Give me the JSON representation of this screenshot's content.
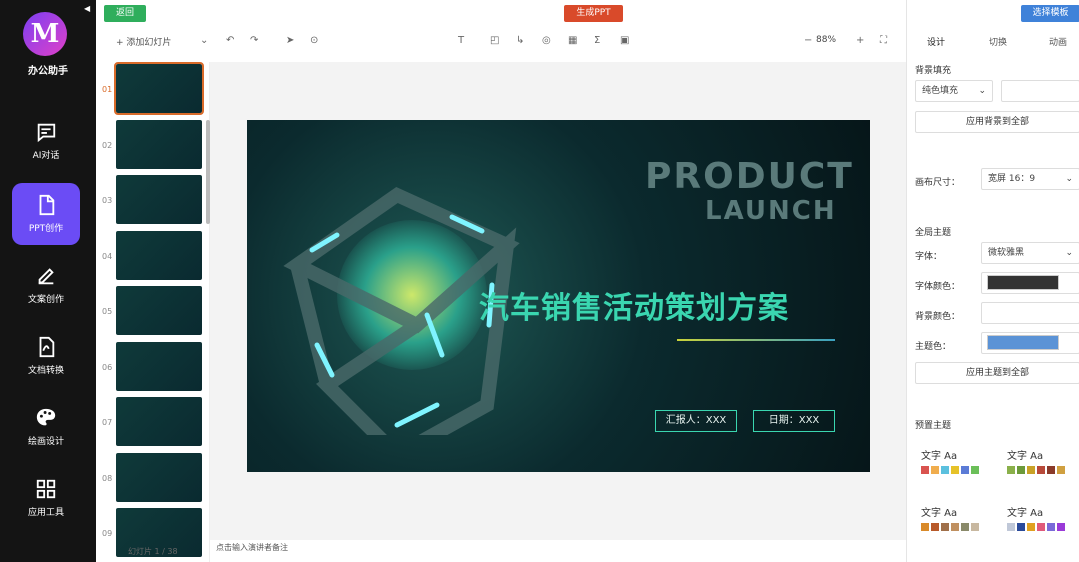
{
  "nav": {
    "app_name": "办公助手",
    "logo_letter": "M",
    "items": [
      {
        "label": "AI对话",
        "icon": "chat-icon"
      },
      {
        "label": "PPT创作",
        "icon": "ppt-icon",
        "active": true
      },
      {
        "label": "文案创作",
        "icon": "edit-icon"
      },
      {
        "label": "文档转换",
        "icon": "pdf-icon"
      },
      {
        "label": "绘画设计",
        "icon": "palette-icon"
      },
      {
        "label": "应用工具",
        "icon": "apps-icon"
      }
    ]
  },
  "toolbar": {
    "back_label": "返回",
    "generate_label": "生成PPT",
    "add_slide_label": "+ 添加幻灯片",
    "zoom_label": "88%",
    "zoom_minus": "−",
    "zoom_plus": "+"
  },
  "thumbs": {
    "numbers": [
      "01",
      "02",
      "03",
      "04",
      "05",
      "06",
      "07",
      "08",
      "09"
    ],
    "slide_count": "幻灯片 1 / 38"
  },
  "slide": {
    "title_en_1": "PRODUCT",
    "title_en_2": "LAUNCH",
    "title_cn": "汽车销售活动策划方案",
    "reporter": "汇报人：XXX",
    "date": "日期：XXX"
  },
  "notes_placeholder": "点击输入演讲者备注",
  "panel": {
    "template_button": "选择模板",
    "tabs": [
      "设计",
      "切换",
      "动画"
    ],
    "bg_fill_label": "背景填充",
    "bg_fill_value": "纯色填充",
    "apply_bg_label": "应用背景到全部",
    "canvas_size_label": "画布尺寸：",
    "canvas_size_value": "宽屏 16：9",
    "global_theme_label": "全局主题",
    "font_label": "字体：",
    "font_value": "微软雅黑",
    "font_color_label": "字体颜色：",
    "bg_color_label": "背景颜色：",
    "theme_color_label": "主题色：",
    "apply_theme_label": "应用主题到全部",
    "preset_label": "预置主题",
    "theme_sample": "文字 Aa",
    "font_color": "#333333",
    "theme_color": "#5b93d6"
  }
}
